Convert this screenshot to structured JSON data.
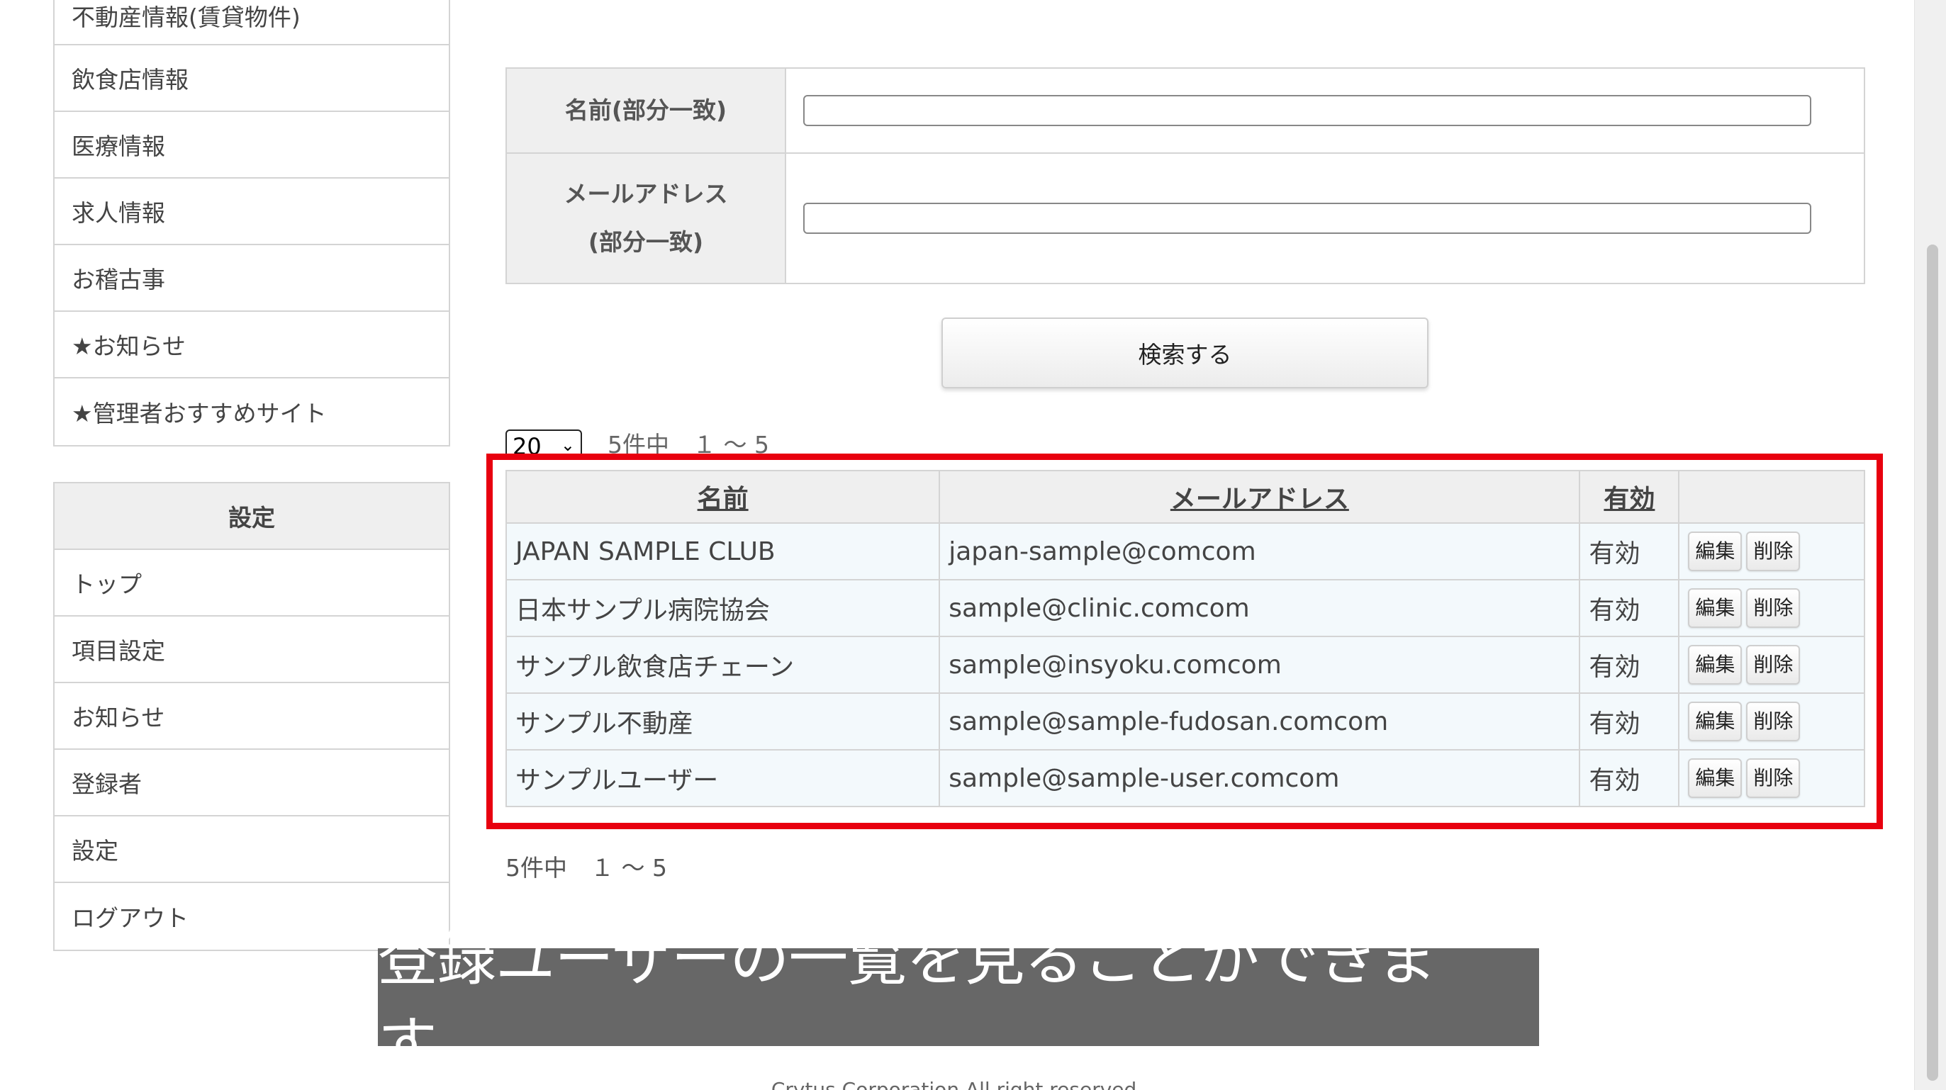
{
  "sidebar_top": {
    "items": [
      "不動産情報(賃貸物件)",
      "飲食店情報",
      "医療情報",
      "求人情報",
      "お稽古事",
      "★お知らせ",
      "★管理者おすすめサイト"
    ]
  },
  "sidebar_settings": {
    "header": "設定",
    "items": [
      "トップ",
      "項目設定",
      "お知らせ",
      "登録者",
      "設定",
      "ログアウト"
    ]
  },
  "search": {
    "name_label": "名前(部分一致)",
    "email_label_1": "メールアドレス",
    "email_label_2": "(部分一致)",
    "name_value": "",
    "email_value": "",
    "button_label": "検索する"
  },
  "paging": {
    "per_page": "20",
    "count_top": "5件中　１ 〜 5",
    "count_bottom": "5件中　１ 〜 5"
  },
  "table": {
    "headers": {
      "name": "名前",
      "email": "メールアドレス",
      "active": "有効"
    },
    "rows": [
      {
        "name": "JAPAN SAMPLE CLUB",
        "email": "japan-sample@comcom",
        "active": "有効",
        "edit": "編集",
        "delete": "削除"
      },
      {
        "name": "日本サンプル病院協会",
        "email": "sample@clinic.comcom",
        "active": "有効",
        "edit": "編集",
        "delete": "削除"
      },
      {
        "name": "サンプル飲食店チェーン",
        "email": "sample@insyoku.comcom",
        "active": "有効",
        "edit": "編集",
        "delete": "削除"
      },
      {
        "name": "サンプル不動産",
        "email": "sample@sample-fudosan.comcom",
        "active": "有効",
        "edit": "編集",
        "delete": "削除"
      },
      {
        "name": "サンプルユーザー",
        "email": "sample@sample-user.comcom",
        "active": "有効",
        "edit": "編集",
        "delete": "削除"
      }
    ]
  },
  "caption": "登録ユーザーの一覧を見ることができます。",
  "footer": "Crytus Corporation All right reserved.",
  "colors": {
    "highlight": "#e8000f",
    "caption_bg": "#5a5a5a",
    "row_bg": "#f3f9fc"
  }
}
